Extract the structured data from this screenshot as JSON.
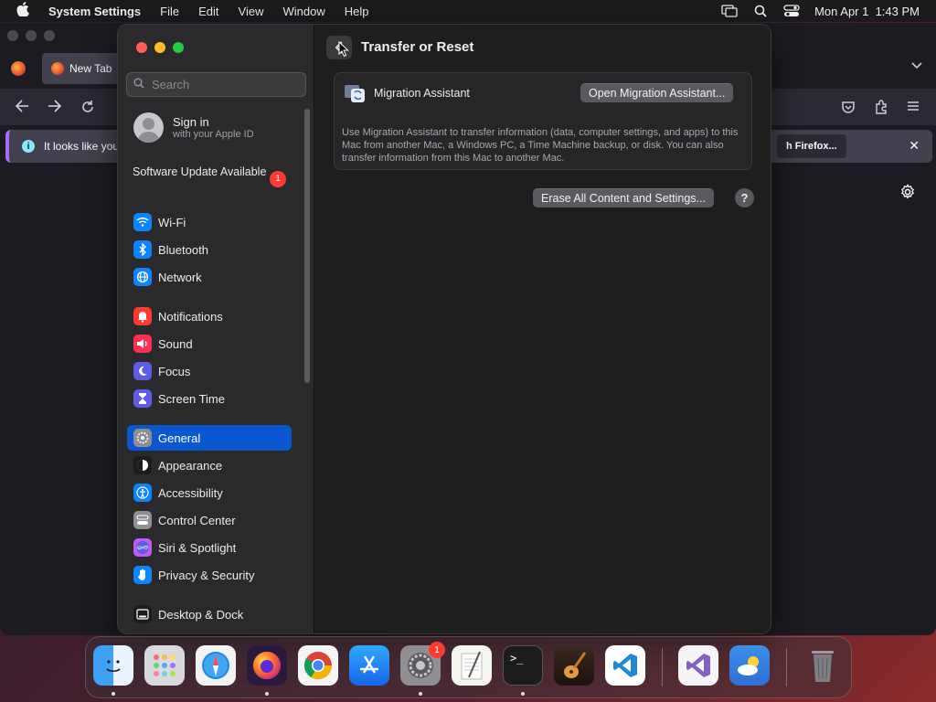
{
  "menubar": {
    "app_name": "System Settings",
    "items": [
      "File",
      "Edit",
      "View",
      "Window",
      "Help"
    ],
    "clock": "Mon Apr 1  1:43 PM"
  },
  "firefox": {
    "tab_label": "New Tab",
    "notice_text": "It looks like you",
    "notice_button": "h Firefox..."
  },
  "sidebar": {
    "search_placeholder": "Search",
    "signin_title": "Sign in",
    "signin_subtitle": "with your Apple ID",
    "update_label": "Software Update Available",
    "update_badge": "1",
    "items": [
      {
        "label": "Wi-Fi",
        "icon": "wifi-icon",
        "color": "#0a84ff"
      },
      {
        "label": "Bluetooth",
        "icon": "bluetooth-icon",
        "color": "#0a84ff"
      },
      {
        "label": "Network",
        "icon": "globe-icon",
        "color": "#0a84ff"
      },
      {
        "label": "Notifications",
        "icon": "bell-icon",
        "color": "#ff3b30"
      },
      {
        "label": "Sound",
        "icon": "speaker-icon",
        "color": "#ff2d55"
      },
      {
        "label": "Focus",
        "icon": "moon-icon",
        "color": "#5e5ce6"
      },
      {
        "label": "Screen Time",
        "icon": "hourglass-icon",
        "color": "#5e5ce6"
      },
      {
        "label": "General",
        "icon": "gear-icon",
        "color": "#8e8e93"
      },
      {
        "label": "Appearance",
        "icon": "appearance-icon",
        "color": "#1c1c1e"
      },
      {
        "label": "Accessibility",
        "icon": "accessibility-icon",
        "color": "#0a84ff"
      },
      {
        "label": "Control Center",
        "icon": "control-center-icon",
        "color": "#8e8e93"
      },
      {
        "label": "Siri & Spotlight",
        "icon": "siri-icon",
        "color": "#bf5af2"
      },
      {
        "label": "Privacy & Security",
        "icon": "hand-icon",
        "color": "#0a84ff"
      },
      {
        "label": "Desktop & Dock",
        "icon": "dock-icon",
        "color": "#1c1c1e"
      }
    ],
    "selected": "General"
  },
  "main": {
    "title": "Transfer or Reset",
    "migration_name": "Migration Assistant",
    "migration_button": "Open Migration Assistant...",
    "migration_desc": "Use Migration Assistant to transfer information (data, computer settings, and apps) to this Mac from another Mac, a Windows PC, a Time Machine backup, or disk. You can also transfer information from this Mac to another Mac.",
    "erase_button": "Erase All Content and Settings...",
    "help_label": "?"
  },
  "dock": {
    "apps": [
      "finder",
      "launchpad",
      "safari",
      "firefox",
      "chrome",
      "app-store",
      "system-settings",
      "textedit",
      "terminal",
      "garageband",
      "vscode",
      "visual-studio",
      "weather",
      "trash"
    ],
    "settings_badge": "1"
  }
}
